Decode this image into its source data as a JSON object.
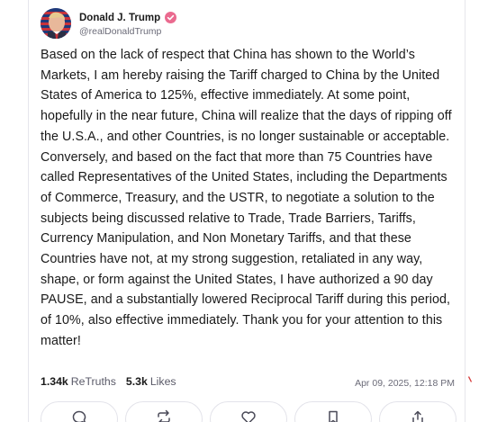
{
  "author": {
    "display_name": "Donald J. Trump",
    "handle": "@realDonaldTrump",
    "verified": true,
    "verified_color": "#ea6a8f"
  },
  "post": {
    "text": "Based on the lack of respect that China has shown to the World’s Markets, I am hereby raising the Tariff charged to China by the United States of America to 125%, effective immediately. At some point, hopefully in the near future, China will realize that the days of ripping off the U.S.A., and other Countries, is no longer sustainable or acceptable. Conversely, and based on the fact that more than 75 Countries have called Representatives of the United States, including the Departments of Commerce, Treasury, and the USTR, to negotiate a solution to the subjects being discussed relative to Trade, Trade Barriers, Tariffs, Currency Manipulation, and Non Monetary Tariffs, and that these Countries have not, at my strong suggestion, retaliated in any way, shape, or form against the United States, I have authorized a 90 day PAUSE, and a substantially lowered Reciprocal Tariff during this period, of 10%, also effective immediately. Thank you for your attention to this matter!",
    "timestamp": "Apr 09, 2025, 12:18 PM"
  },
  "stats": {
    "retruths_count": "1.34k",
    "retruths_label": "ReTruths",
    "likes_count": "5.3k",
    "likes_label": "Likes"
  },
  "actions": [
    {
      "icon": "reply-icon"
    },
    {
      "icon": "retruth-icon"
    },
    {
      "icon": "like-icon"
    },
    {
      "icon": "bookmark-icon"
    },
    {
      "icon": "share-icon"
    }
  ]
}
